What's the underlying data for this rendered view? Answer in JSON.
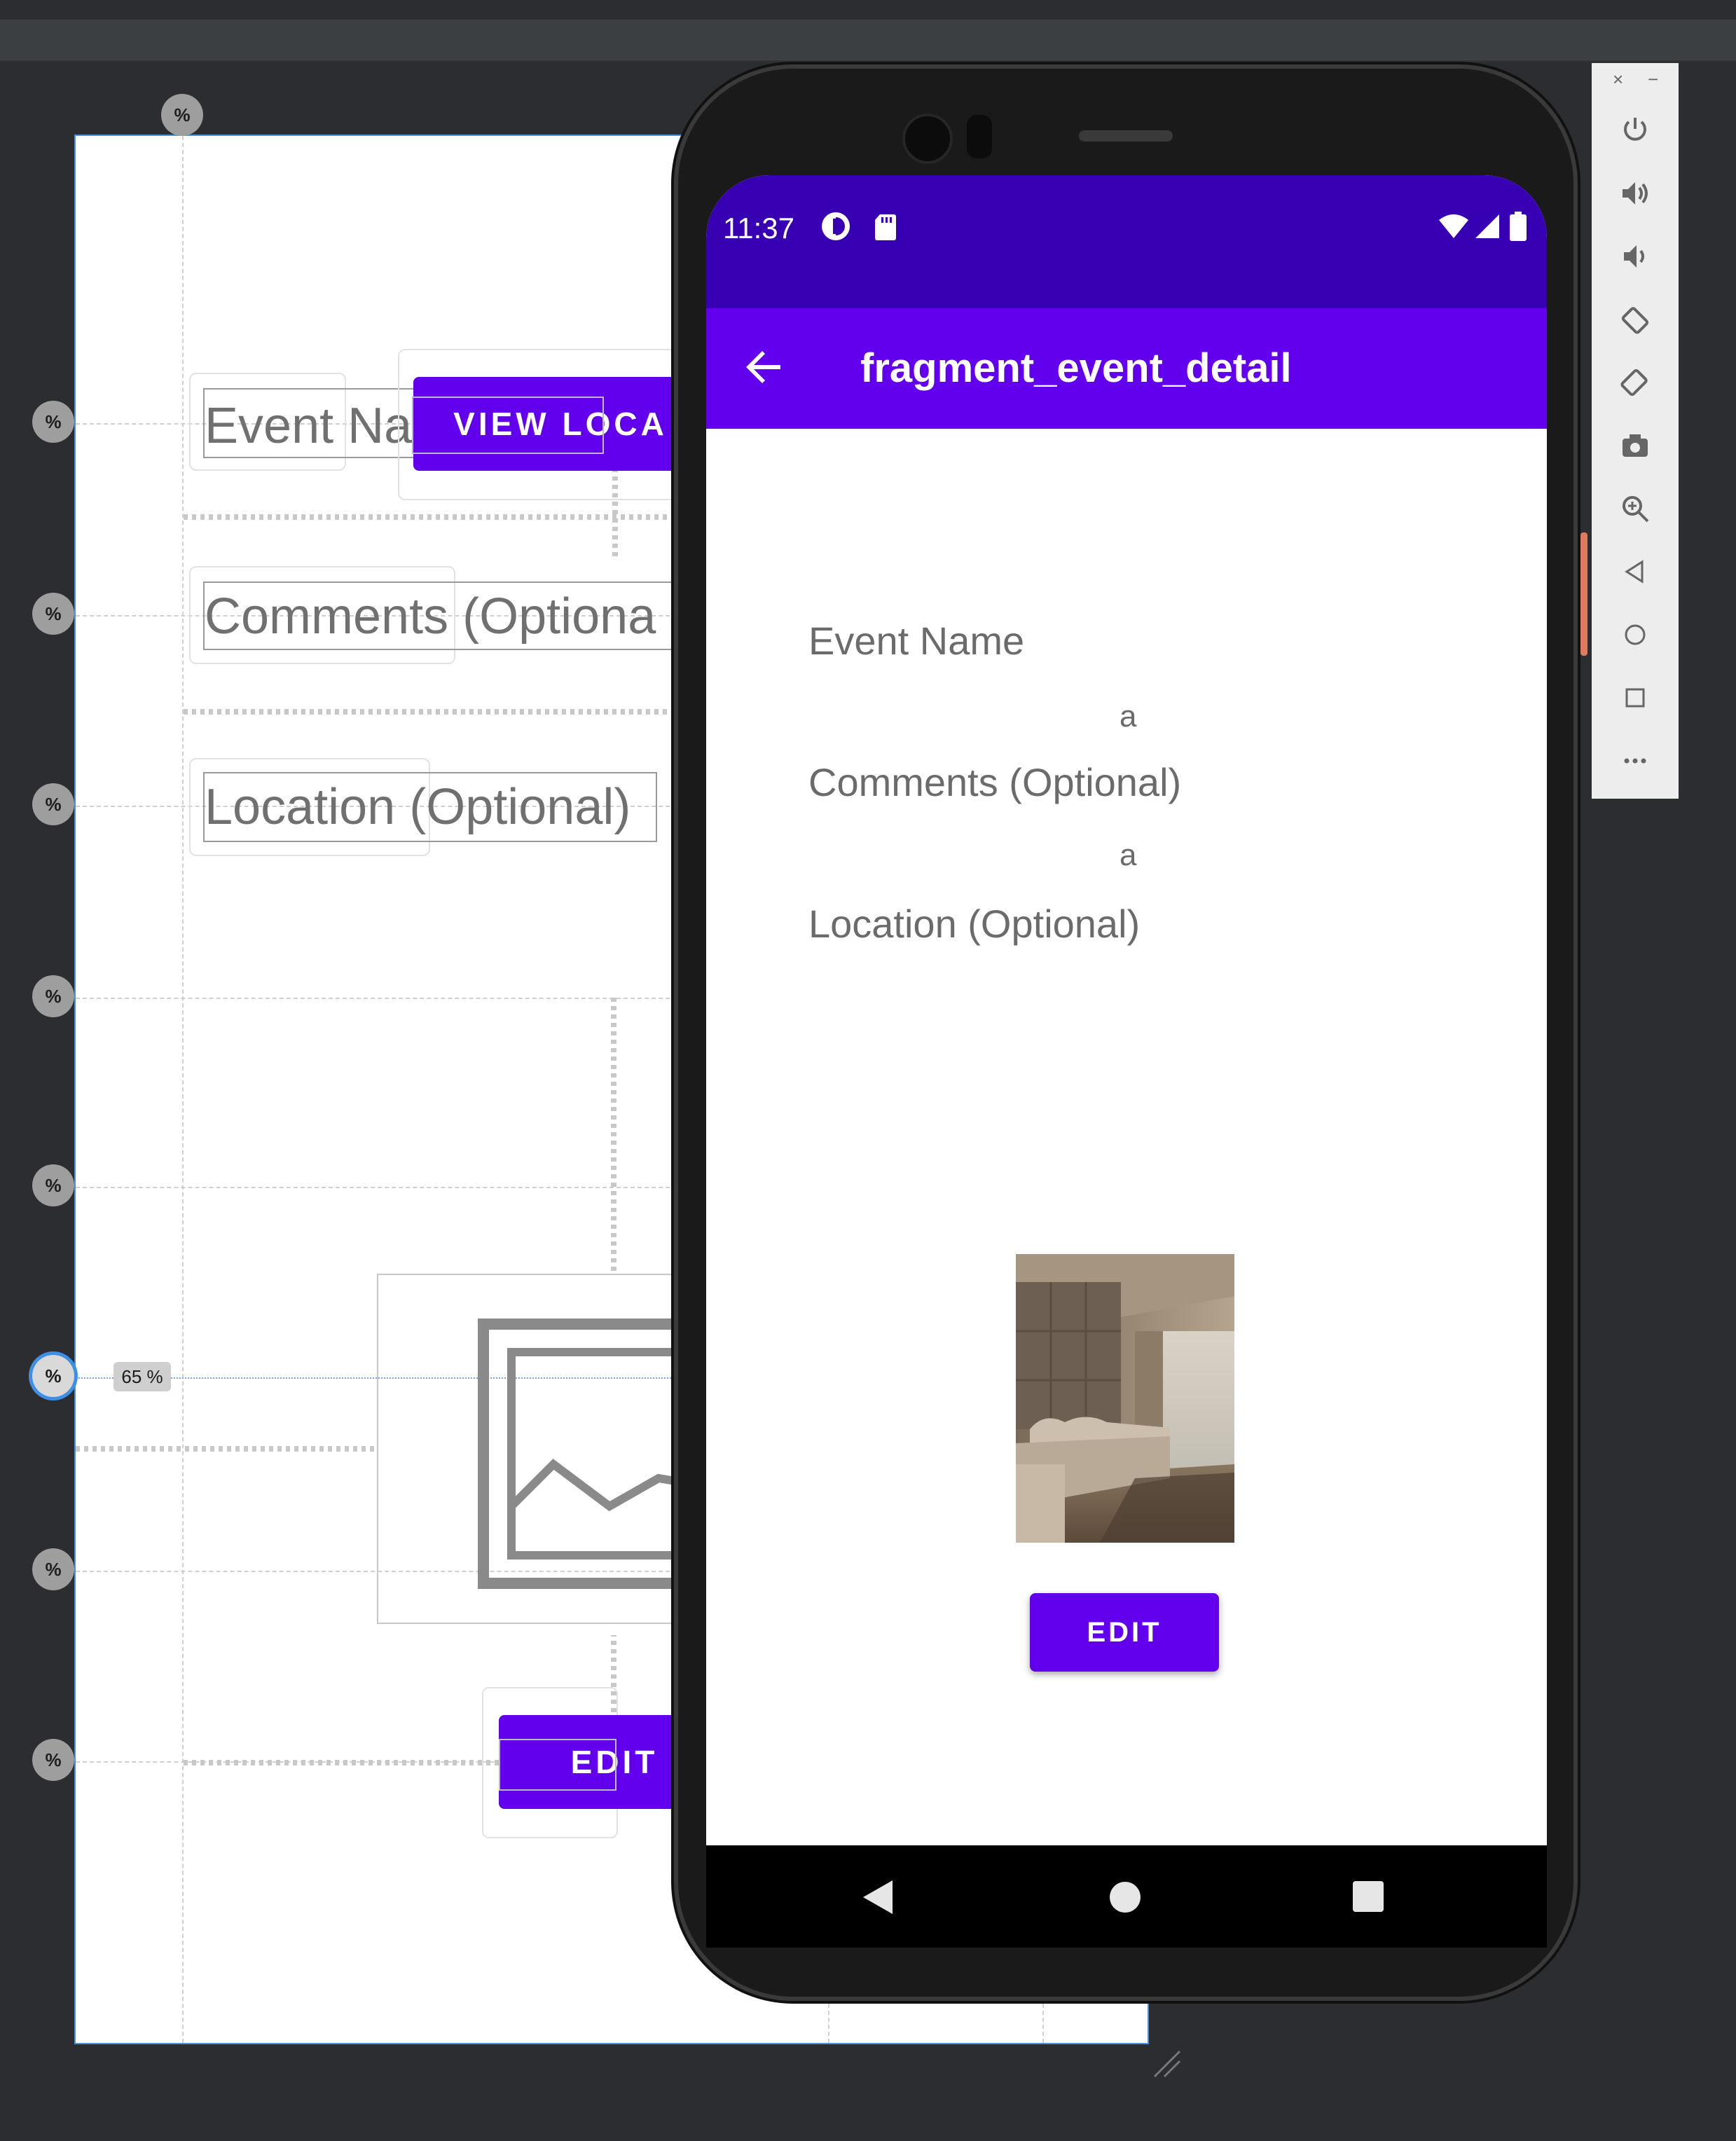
{
  "design_canvas": {
    "event_name_ghost": "Event Na",
    "view_location_ghost": "VIEW LOCA",
    "comments_ghost": "Comments (Optiona",
    "location_ghost": "Location (Optional)",
    "edit_ghost": "EDIT",
    "percent_symbol": "%",
    "guideline_value": "65 %"
  },
  "phone": {
    "status_bar": {
      "time": "11:37"
    },
    "app_bar": {
      "title": "fragment_event_detail"
    },
    "content": {
      "event_name_label": "Event Name",
      "event_name_value": "a",
      "comments_label": "Comments (Optional)",
      "comments_value": "a",
      "location_label": "Location (Optional)"
    },
    "edit_label": "EDIT"
  },
  "emulator_toolbar": {
    "close": "×",
    "minimize": "−"
  },
  "colors": {
    "primary": "#6200ee",
    "primary_dark": "#3700b3"
  }
}
